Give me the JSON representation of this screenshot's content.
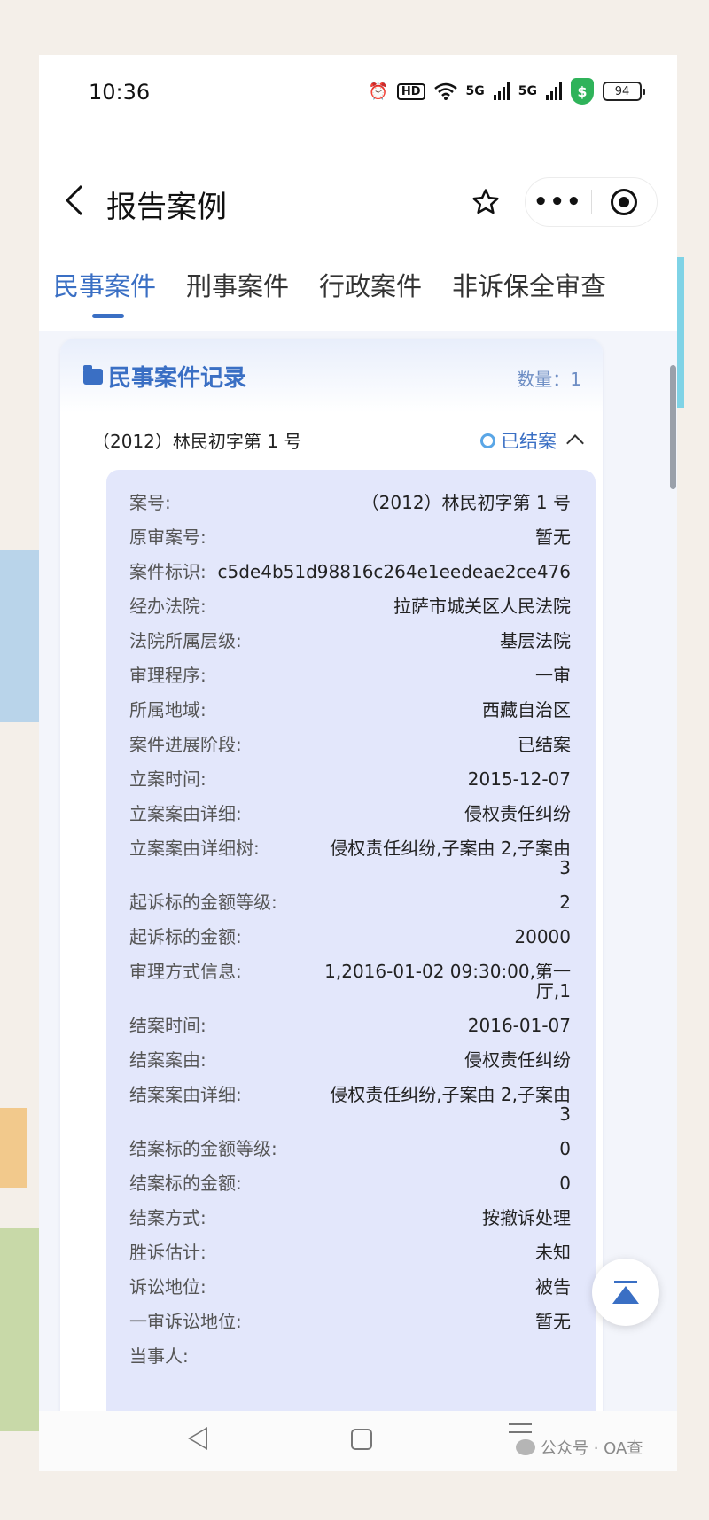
{
  "status_bar": {
    "time": "10:36",
    "hd_label": "HD",
    "signal1_label": "5G",
    "signal2_label": "5G",
    "shield_symbol": "$",
    "battery": "94"
  },
  "nav": {
    "title": "报告案例",
    "more_label": "•••"
  },
  "tabs": [
    {
      "label": "民事案件",
      "active": true
    },
    {
      "label": "刑事案件",
      "active": false
    },
    {
      "label": "行政案件",
      "active": false
    },
    {
      "label": "非诉保全审查",
      "active": false
    }
  ],
  "card": {
    "title": "民事案件记录",
    "count": "数量：1",
    "case_title": "（2012）林民初字第 1 号",
    "case_status": "已结案",
    "fields": [
      {
        "label": "案号:",
        "value": "（2012）林民初字第 1 号"
      },
      {
        "label": "原审案号:",
        "value": "暂无"
      },
      {
        "label": "案件标识:",
        "value": "c5de4b51d98816c264e1eedeae2ce476"
      },
      {
        "label": "经办法院:",
        "value": "拉萨市城关区人民法院"
      },
      {
        "label": "法院所属层级:",
        "value": "基层法院"
      },
      {
        "label": "审理程序:",
        "value": "一审"
      },
      {
        "label": "所属地域:",
        "value": "西藏自治区"
      },
      {
        "label": "案件进展阶段:",
        "value": "已结案"
      },
      {
        "label": "立案时间:",
        "value": "2015-12-07"
      },
      {
        "label": "立案案由详细:",
        "value": "侵权责任纠纷"
      },
      {
        "label": "立案案由详细树:",
        "value": "侵权责任纠纷,子案由 2,子案由 3"
      },
      {
        "label": "起诉标的金额等级:",
        "value": "2"
      },
      {
        "label": "起诉标的金额:",
        "value": "20000"
      },
      {
        "label": "审理方式信息:",
        "value": "1,2016-01-02 09:30:00,第一厅,1"
      },
      {
        "label": "结案时间:",
        "value": "2016-01-07"
      },
      {
        "label": "结案案由:",
        "value": "侵权责任纠纷"
      },
      {
        "label": "结案案由详细:",
        "value": "侵权责任纠纷,子案由 2,子案由 3"
      },
      {
        "label": "结案标的金额等级:",
        "value": "0"
      },
      {
        "label": "结案标的金额:",
        "value": "0"
      },
      {
        "label": "结案方式:",
        "value": "按撤诉处理"
      },
      {
        "label": "胜诉估计:",
        "value": "未知"
      },
      {
        "label": "诉讼地位:",
        "value": "被告"
      },
      {
        "label": "一审诉讼地位:",
        "value": "暂无"
      },
      {
        "label": "当事人:",
        "value": ""
      }
    ]
  },
  "watermark": "公众号 · OA查",
  "colors": {
    "accent": "#3a6fc4",
    "detail_bg": "#e3e7fb",
    "status_ring": "#5aa6e6"
  }
}
